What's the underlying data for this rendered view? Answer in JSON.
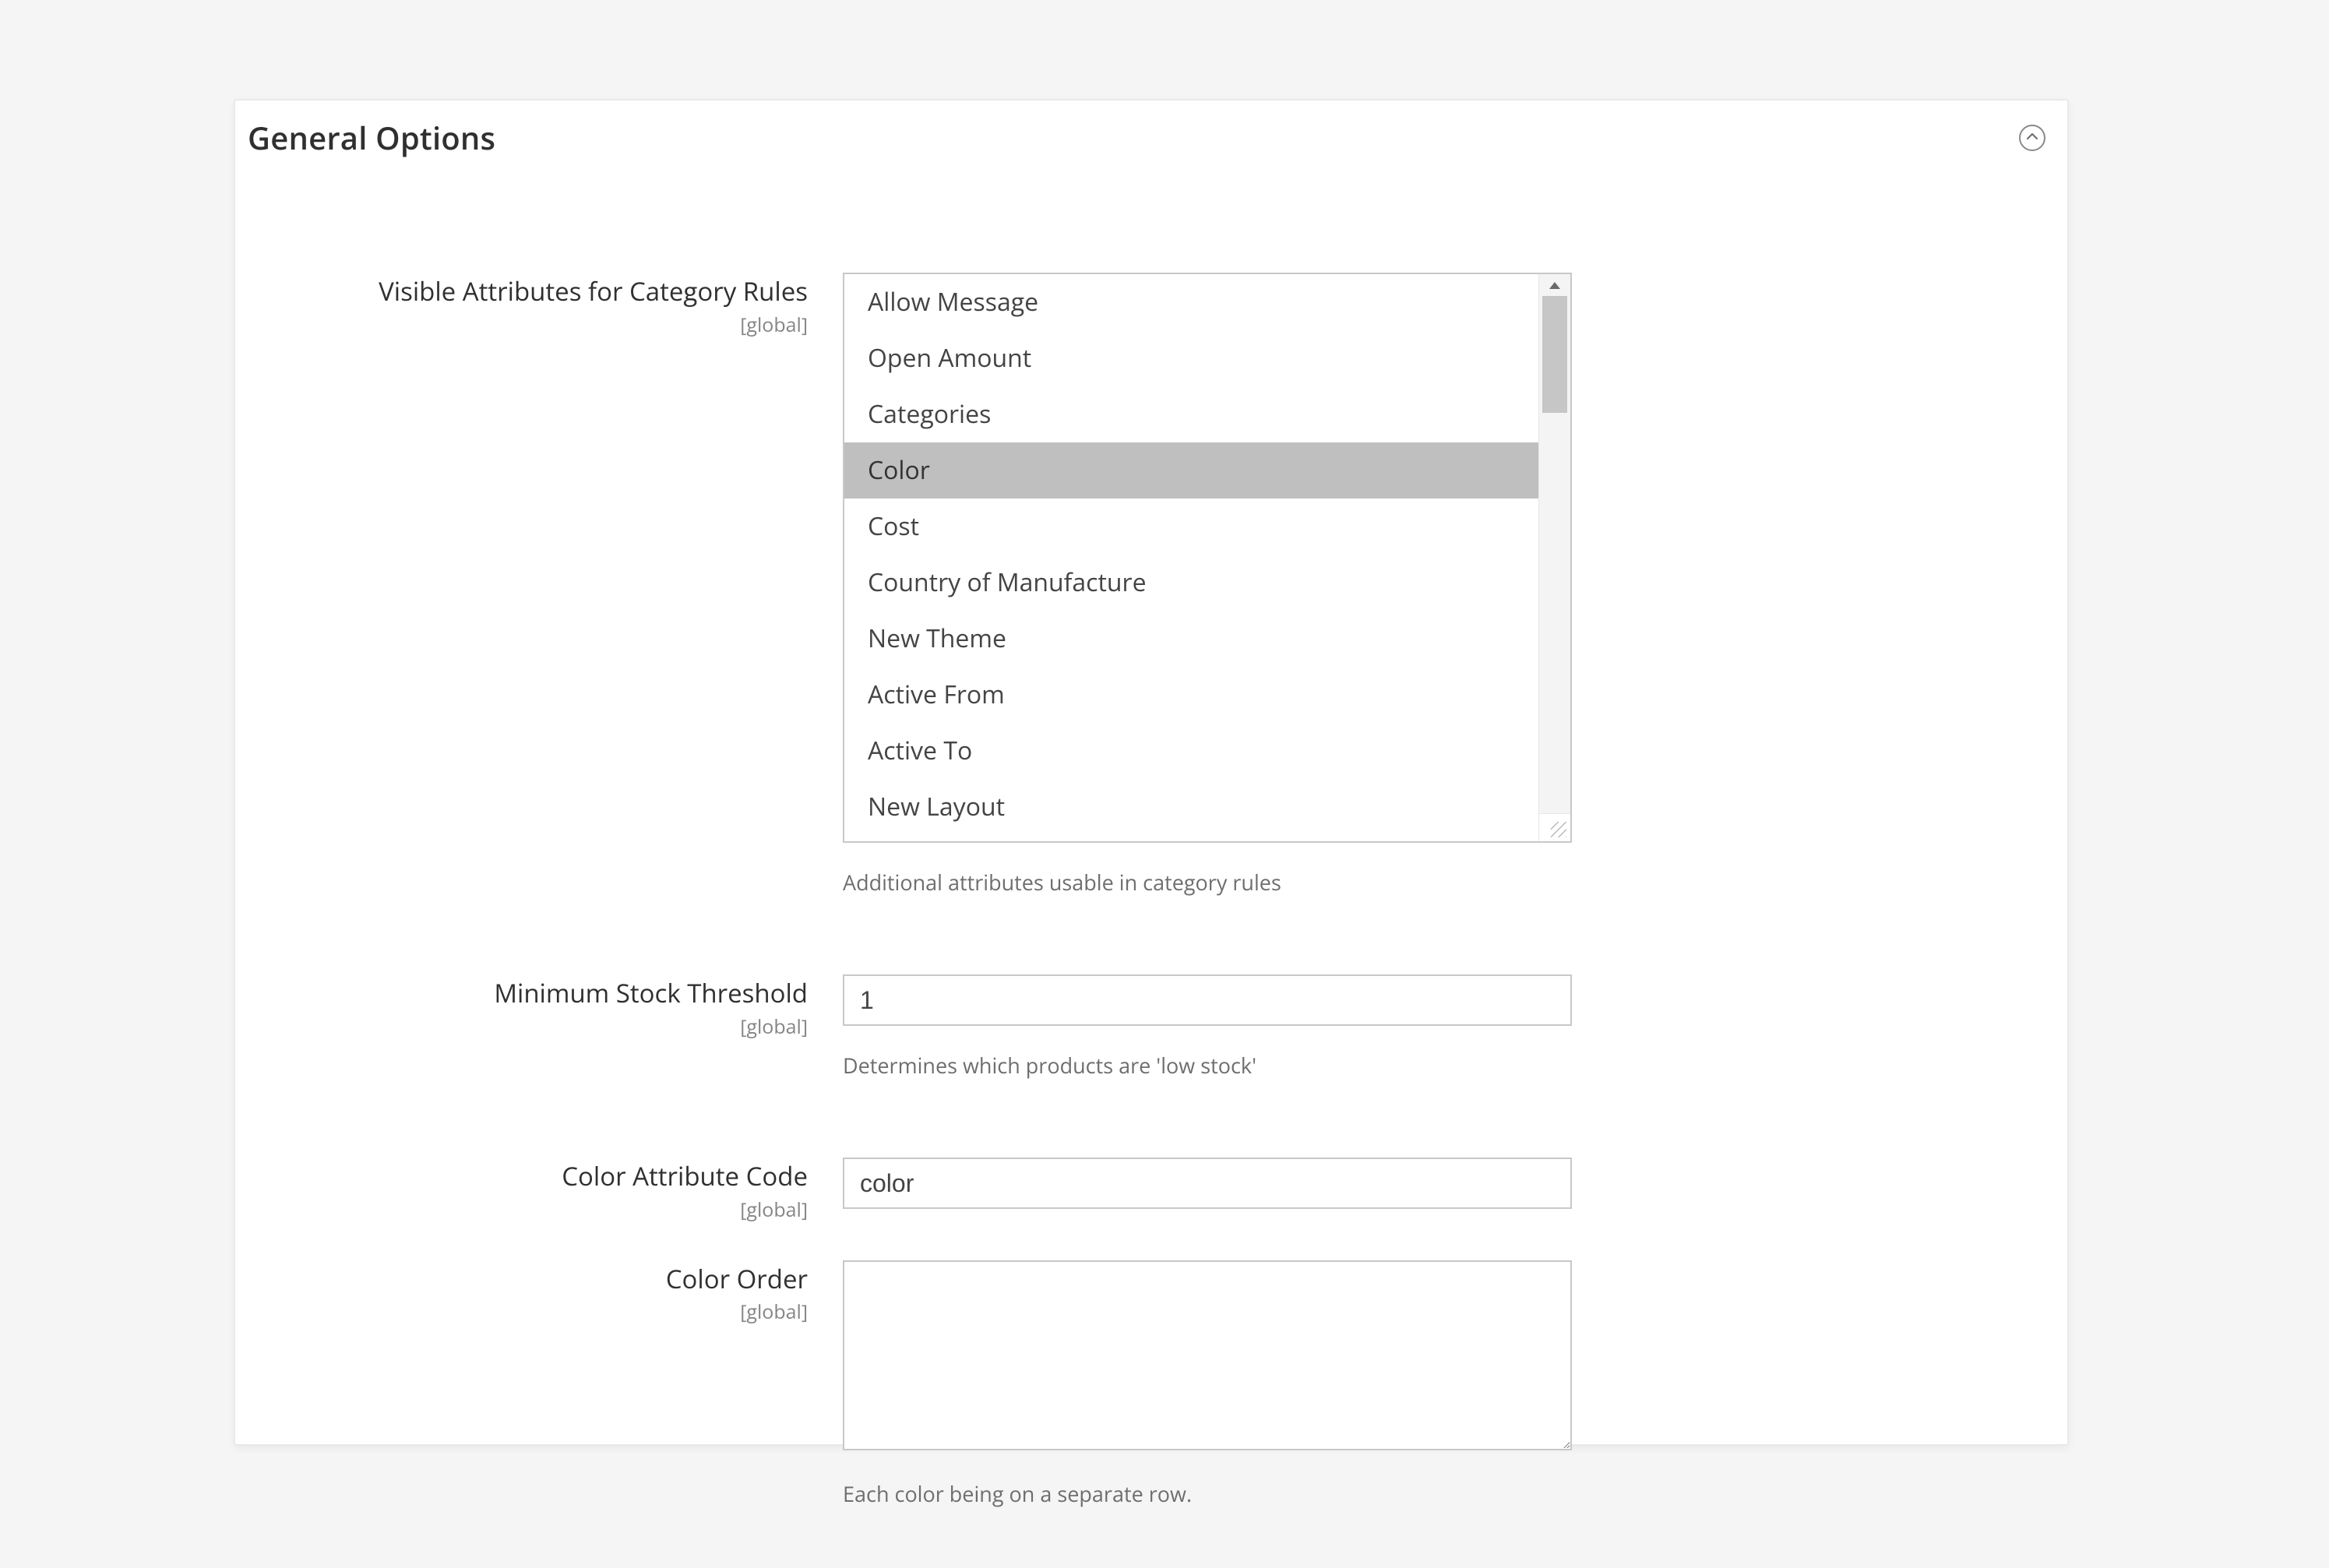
{
  "panel": {
    "title": "General Options"
  },
  "fields": {
    "visible_attributes": {
      "label": "Visible Attributes for Category Rules",
      "scope": "[global]",
      "options": [
        "Allow Message",
        "Open Amount",
        "Categories",
        "Color",
        "Cost",
        "Country of Manufacture",
        "New Theme",
        "Active From",
        "Active To",
        "New Layout"
      ],
      "selected": [
        "Color"
      ],
      "note": "Additional attributes usable in category rules"
    },
    "min_stock": {
      "label": "Minimum Stock Threshold",
      "scope": "[global]",
      "value": "1",
      "note": "Determines which products are 'low stock'"
    },
    "color_code": {
      "label": "Color Attribute Code",
      "scope": "[global]",
      "value": "color"
    },
    "color_order": {
      "label": "Color Order",
      "scope": "[global]",
      "value": "",
      "note": "Each color being on a separate row."
    }
  }
}
